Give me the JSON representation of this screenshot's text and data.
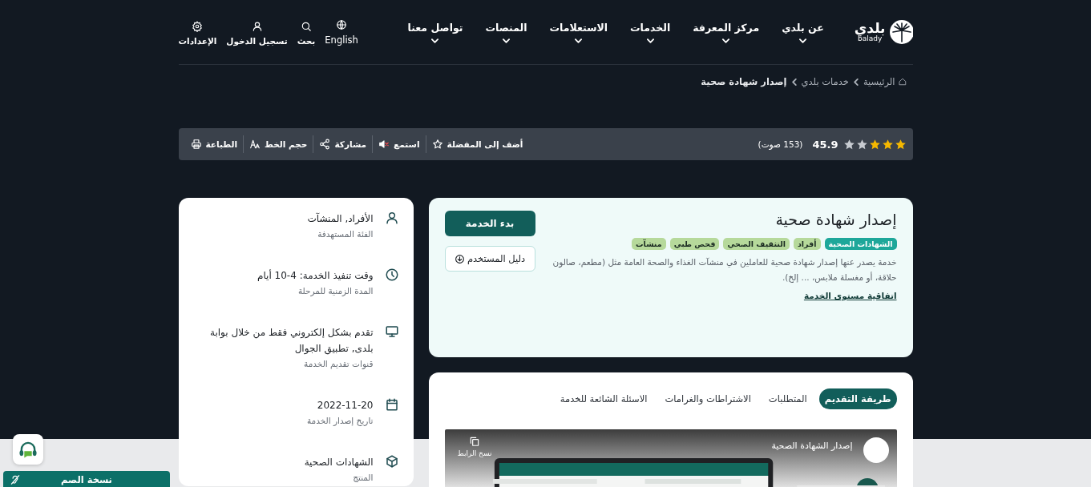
{
  "header": {
    "logo": {
      "arabic": "بلدي",
      "latin": "balady"
    },
    "nav": [
      {
        "label": "عن بلدي",
        "dropdown": true
      },
      {
        "label": "مركز المعرفة",
        "dropdown": true
      },
      {
        "label": "الخدمات",
        "dropdown": true
      },
      {
        "label": "الاستعلامات",
        "dropdown": true
      },
      {
        "label": "المنصات",
        "dropdown": true
      },
      {
        "label": "تواصل معنا",
        "dropdown": true
      }
    ],
    "tools": [
      {
        "kind": "globe",
        "label": "English"
      },
      {
        "kind": "search",
        "label": "بحث"
      },
      {
        "kind": "user",
        "label": "تسجيل الدخول"
      },
      {
        "kind": "gear",
        "label": "الإعدادات"
      }
    ]
  },
  "breadcrumb": [
    {
      "kind": "home",
      "label": "الرئيسية"
    },
    {
      "kind": "link",
      "label": "خدمات بلدي"
    },
    {
      "kind": "current",
      "label": "إصدار شهادة صحية"
    }
  ],
  "toolbar": {
    "stars": 3,
    "rating": "45.9",
    "votes": "(153 صوت)",
    "actions": [
      {
        "kind": "star",
        "label": "أضف إلى المفضلة"
      },
      {
        "kind": "speaker",
        "label": "استمع"
      },
      {
        "kind": "share",
        "label": "مشاركة"
      },
      {
        "kind": "font",
        "label": "حجم الخط"
      },
      {
        "kind": "print",
        "label": "الطباعة"
      }
    ]
  },
  "service": {
    "title": "إصدار شهادة صحية",
    "tags": [
      {
        "label": "الشهادات الصحية",
        "color": "#1ea79a"
      },
      {
        "label": "أفراد",
        "color": "#b6d99b"
      },
      {
        "label": "التثقيف الصحي",
        "color": "#b6d99b"
      },
      {
        "label": "فحص طبي",
        "color": "#b6d99b"
      },
      {
        "label": "منشآت",
        "color": "#b6d99b"
      }
    ],
    "description": "خدمة يصدر عنها إصدار شهادة صحية للعاملين في منشآت الغذاء والصحة العامة مثل (مطعم، صالون حلاقة، أو مغسلة ملابس، ... إلخ).",
    "link": "اتفاقية مستوى الخدمة",
    "start_button": "بدء الخدمة",
    "guide_button": "دليل المستخدم"
  },
  "tabs": [
    {
      "label": "طريقة التقديم",
      "selected": true
    },
    {
      "label": "المتطلبات",
      "selected": false
    },
    {
      "label": "الاشتراطات والغرامات",
      "selected": false
    },
    {
      "label": "الاسئلة الشائعة للخدمة",
      "selected": false
    }
  ],
  "video": {
    "title": "إصدار الشهادة الصحية",
    "copy_link": "نسخ الرابط"
  },
  "details": [
    {
      "kind": "user",
      "value": "الأفراد, المنشآت",
      "label": "الفئة المستهدفة"
    },
    {
      "kind": "clock",
      "value": "وقت تنفيذ الخدمة: 4-10 أيام",
      "label": "المدة الزمنية للمرحلة"
    },
    {
      "kind": "monitor",
      "value": "تقدم بشكل إلكتروني فقط من خلال بوابة بلدى, تطبيق الجوال",
      "label": "قنوات تقديم الخدمة"
    },
    {
      "kind": "calendar",
      "value": "2022-11-20",
      "label": "تاريخ إصدار الخدمة"
    },
    {
      "kind": "box",
      "value": "الشهادات الصحية",
      "label": "المنتج"
    }
  ],
  "accessibility": {
    "deaf_version": "نسخة الصم"
  }
}
